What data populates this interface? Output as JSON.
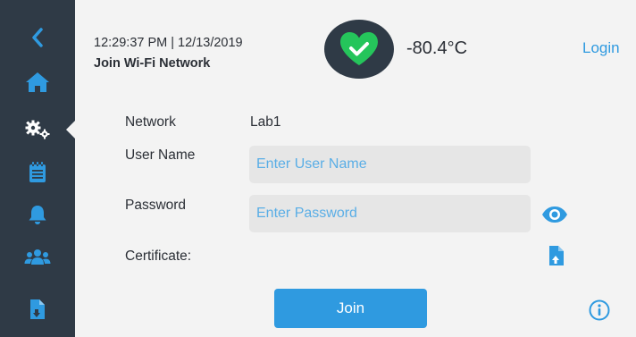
{
  "header": {
    "datetime": "12:29:37 PM | 12/13/2019",
    "title": "Join Wi-Fi Network",
    "temperature": "-80.4°C",
    "login_label": "Login",
    "status_icon": "heart-check-icon"
  },
  "sidebar": {
    "items": [
      {
        "icon": "back-chevron-icon"
      },
      {
        "icon": "home-icon"
      },
      {
        "icon": "settings-gears-icon",
        "active": true
      },
      {
        "icon": "notepad-icon"
      },
      {
        "icon": "bell-icon"
      },
      {
        "icon": "users-icon"
      },
      {
        "icon": "file-download-icon"
      }
    ]
  },
  "form": {
    "network_label": "Network",
    "network_value": "Lab1",
    "username_label": "User Name",
    "username_placeholder": "Enter User Name",
    "username_value": "",
    "password_label": "Password",
    "password_placeholder": "Enter Password",
    "password_value": "",
    "certificate_label": "Certificate:",
    "join_label": "Join"
  },
  "colors": {
    "sidebar": "#2f3a46",
    "accent": "#2f9ae0",
    "status_green": "#25c55b",
    "background": "#f3f3f3"
  }
}
